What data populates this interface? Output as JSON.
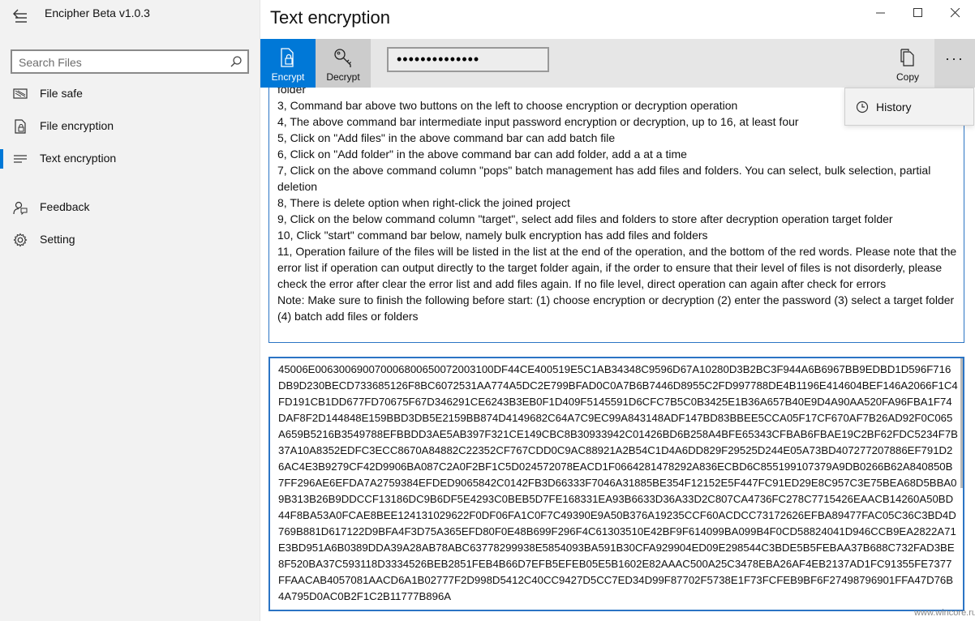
{
  "app": {
    "title": "Encipher  Beta v1.0.3",
    "page_title": "Text encryption"
  },
  "sidebar": {
    "search_placeholder": "Search Files",
    "items": [
      {
        "label": "File safe",
        "icon": "safe-icon"
      },
      {
        "label": "File encryption",
        "icon": "file-lock-icon"
      },
      {
        "label": "Text encryption",
        "icon": "text-lines-icon",
        "active": true
      },
      {
        "label": "Feedback",
        "icon": "feedback-icon"
      },
      {
        "label": "Setting",
        "icon": "gear-icon"
      }
    ]
  },
  "commandbar": {
    "encrypt_label": "Encrypt",
    "decrypt_label": "Decrypt",
    "password_value": "••••••••••••••",
    "copy_label": "Copy",
    "more_label": "···"
  },
  "menu": {
    "history_label": "History"
  },
  "input_text": {
    "lines": [
      "folder",
      "3, Command bar above two buttons on the left to choose encryption or decryption operation",
      "4, The above command bar intermediate input password encryption or decryption, up to 16, at least four",
      "5, Click on \"Add files\" in the above command bar can add batch file",
      "6, Click on \"Add folder\" in the above command bar can add folder, add a at a time",
      "7, Click on the above command column \"pops\" batch management has add files and folders. You can select, bulk selection, partial deletion",
      "8, There is delete option when right-click the joined project",
      "9, Click on the below command column \"target\", select add files and folders to store after decryption operation target folder",
      "10, Click \"start\" command bar below, namely bulk encryption has add files and folders",
      "11, Operation failure of the files will be listed in the list at the end of the operation, and the bottom of the red words. Please note that the error list if operation can output directly to the target folder again, if the order to ensure that their level of files is not disorderly, please check the error after clear the error list and add files again. If no file level, direct operation can again after check for errors",
      "Note: Make sure to finish the following before start: (1) choose encryption or decryption (2) enter the password (3) select a target folder (4) batch add files or folders"
    ]
  },
  "output_text": "45006E0063006900700068006500720031​00DF44CE400519E5C1AB34348C9596D67A10280D3B2BC3F944A6B6967BB9EDBD1D596F716DB9D230BECD733685126F8BC6072531AA774A5DC2E799BFAD0C0A7B6B7446D8955C2FD997788DE4B1196E414604BEF146A2066F1C4FD191CB1DD677FD70675F67D346291CE6243B3EB0F1D409F5145591D6CFC7B5C0B3425E1B36A657B40E9D4A90AA520FA96FBA1F74DAF8F2D144848E159BBD3DB5E2159BB874D4149682C64A7C9EC99A843148ADF147BD83BBEE5CCA05F17CF670AF7B26AD92F0C065A659B5216B3549788EFBBDD3AE5AB397F321CE149CBC8B30933942C01426BD6B258A4BFE65343CFBAB6FBAE19C2BF62FDC5234F7B37A10A8352EDFC3ECC8670A84882C22352CF767CDD0C9AC88921A2B54C1D4A6DD829F29525D244E05A73BD407277207886EF791D26AC4E3B9279CF42D9906BA087C2A0F2BF1C5D024572078EACD1F0664281478292A836ECBD6C855199107379A9DB0266B62A840850B7FF296AE6EFDA7A2759384EFDED9065842C0142FB3D66333F7046A31885BE354F12152E5F447FC91ED29E8C957C3E75BEA68D5BBA09B313B26B9DDCCF13186DC9B6DF5E4293C0BEB5D7FE168331EA93B6633D36A33D2C807CA4736FC278C7715426EAACB14260A50BD44F8BA53A0FCAE8BEE124131029622F0DF06FA1C0F7C49390E9A50B376A19235CCF60ACDCC73172626EFBA89477FAC05C36C3BD4D769B881D617122D9BFA4F3D75A365EFD80F0E48B699F296F4C61303510E42BF9F614099BA099B4F0CD58824041D946CCB9EA2822A71E3BD951A6B0389DDA39A28AB78ABC63778299938E5854093BA591B30CFA929904ED09E298544C3BDE5B5FEBAA37B688C732FAD3BE8F520BA37C593118D3334526BEB2851FEB4B66D7EFB5EFEB05E5B1602E82AAAC500A25C3478EBA26AF4EB2137AD1FC91355FE7377FFAACAB4057081AACD6A1B02777F2D998D5412C40CC9427D5CC7ED34D99F87702F5738E1F73FCFEB9BF6F27498796901FFA47D76B4A795D0AC0B2F1C2B11777B896A",
  "watermark": "www.wincore.ru",
  "colors": {
    "accent": "#0078d7",
    "sidebar_bg": "#f2f2f2",
    "commandbar_bg": "#e6e6e6",
    "textbox_border": "#2b74c4"
  }
}
